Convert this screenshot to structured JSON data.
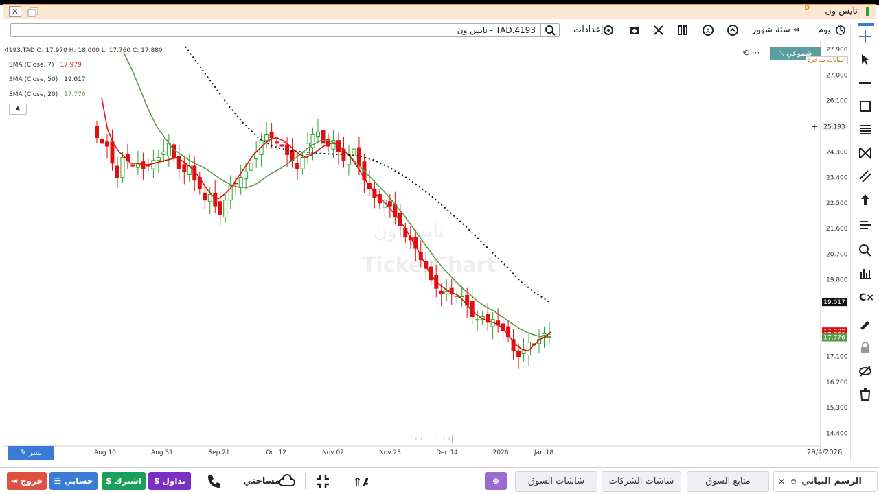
{
  "window": {
    "title": "نايس ون",
    "mark": "D"
  },
  "toolbar": {
    "search_value": "TAD.4193 - نايس ون",
    "settings_label": "إعدادات",
    "period_label": "ستة شهور",
    "interval_label": "يوم"
  },
  "chart_info": {
    "ohlc": "4193.TAD  O: 17.970 H: 18.000 L: 17.760 C: 17.880",
    "sma7_label": "SMA  (Close, 7)",
    "sma7_value": "17.979",
    "sma50_label": "SMA  (Close, 50)",
    "sma50_value": "19.017",
    "sma20_label": "SMA  (Close, 20)",
    "sma20_value": "17.776",
    "chart_type_label": "شموعي",
    "delayed_note": "البيانات متأخرة",
    "watermark_name": "نايس ون",
    "watermark_brand": "TickerChart",
    "crosshair_price": "25.193",
    "last_date": "29/4/2026",
    "publish_label": "نشر"
  },
  "colors": {
    "up": "#26a526",
    "down": "#e01010",
    "sma7": "#e01010",
    "sma20": "#5a9a4a",
    "sma50": "#111111",
    "accent": "#3a7bd5"
  },
  "chart_data": {
    "type": "candlestick",
    "ylim": [
      14.0,
      28.0
    ],
    "y_ticks": [
      "27.900",
      "27.000",
      "26.100",
      "25.193",
      "24.300",
      "23.400",
      "22.500",
      "21.600",
      "20.700",
      "19.800",
      "19.017",
      "17.979",
      "17.880",
      "17.776",
      "17.100",
      "16.200",
      "15.300",
      "14.400"
    ],
    "x_ticks": [
      "Aug 10",
      "Aug 31",
      "Sep 21",
      "Oct 12",
      "Nov 02",
      "Nov 23",
      "Dec 14",
      "2026",
      "Jan 18"
    ],
    "close": [
      24.8,
      24.6,
      24.5,
      23.9,
      23.4,
      24.1,
      24.0,
      23.8,
      23.9,
      23.7,
      23.8,
      24.0,
      24.1,
      24.3,
      24.6,
      24.1,
      23.7,
      23.6,
      23.8,
      23.3,
      23.0,
      22.6,
      22.8,
      22.4,
      22.1,
      22.6,
      23.1,
      23.2,
      23.4,
      23.6,
      23.9,
      24.3,
      24.7,
      24.9,
      24.8,
      24.6,
      24.5,
      24.2,
      24.0,
      23.7,
      24.1,
      24.6,
      24.9,
      25.0,
      24.6,
      24.5,
      24.7,
      24.3,
      24.0,
      24.2,
      24.4,
      23.8,
      23.3,
      23.0,
      22.7,
      22.5,
      22.6,
      22.4,
      22.0,
      21.7,
      21.3,
      21.2,
      20.9,
      20.5,
      20.2,
      19.8,
      19.5,
      19.3,
      19.4,
      19.3,
      19.2,
      19.2,
      18.9,
      18.5,
      18.4,
      18.5,
      18.3,
      18.4,
      18.2,
      18.0,
      17.8,
      17.3,
      17.1,
      17.3,
      17.6,
      17.5,
      17.7,
      17.9,
      17.88
    ],
    "sma7": [
      26.2,
      25.1,
      24.6,
      24.3,
      24.1,
      23.9,
      23.9,
      23.85,
      23.85,
      23.9,
      23.95,
      24.0,
      24.05,
      24.1,
      23.95,
      23.8,
      23.6,
      23.3,
      23.0,
      22.75,
      22.65,
      22.8,
      23.0,
      23.3,
      23.6,
      23.9,
      24.2,
      24.4,
      24.6,
      24.75,
      24.8,
      24.7,
      24.55,
      24.35,
      24.2,
      24.1,
      24.2,
      24.35,
      24.5,
      24.6,
      24.6,
      24.45,
      24.25,
      24.0,
      23.7,
      23.35,
      23.05,
      22.8,
      22.6,
      22.4,
      22.15,
      21.9,
      21.6,
      21.25,
      20.9,
      20.5,
      20.1,
      19.8,
      19.6,
      19.45,
      19.35,
      19.25,
      19.05,
      18.8,
      18.6,
      18.45,
      18.35,
      18.3,
      18.2,
      18.0,
      17.75,
      17.5,
      17.35,
      17.3,
      17.5,
      17.7,
      17.8,
      17.979
    ],
    "sma20": [
      27.8,
      27.2,
      26.5,
      25.8,
      25.2,
      24.8,
      24.4,
      24.2,
      24.0,
      23.85,
      23.7,
      23.5,
      23.3,
      23.15,
      23.05,
      23.05,
      23.15,
      23.35,
      23.55,
      23.7,
      23.9,
      24.1,
      24.35,
      24.55,
      24.7,
      24.7,
      24.55,
      24.3,
      24.0,
      23.7,
      23.4,
      23.1,
      22.8,
      22.45,
      22.1,
      21.7,
      21.3,
      20.9,
      20.5,
      20.15,
      19.85,
      19.55,
      19.3,
      19.05,
      18.85,
      18.7,
      18.5,
      18.3,
      18.1,
      17.95,
      17.85,
      17.78,
      17.776
    ],
    "sma50": [
      28.0,
      27.3,
      26.6,
      25.9,
      25.3,
      24.8,
      24.5,
      24.35,
      24.3,
      24.25,
      24.22,
      24.2,
      24.15,
      24.0,
      23.75,
      23.45,
      23.1,
      22.7,
      22.25,
      21.8,
      21.3,
      20.8,
      20.3,
      19.75,
      19.35,
      19.017
    ]
  }
}
